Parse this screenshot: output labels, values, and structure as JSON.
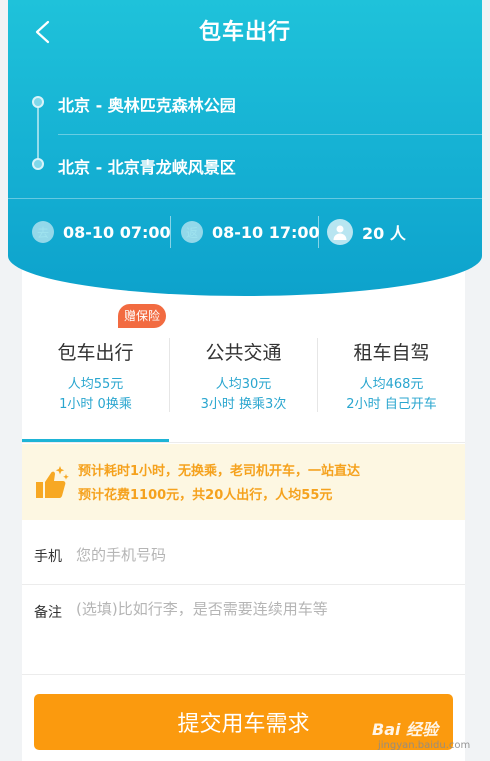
{
  "header": {
    "title": "包车出行",
    "origin": "北京 - 奥林匹克森林公园",
    "destination": "北京 - 北京青龙峡风景区",
    "start_time": "08-10 07:00",
    "end_time": "08-10 17:00",
    "passengers": "20 人"
  },
  "colors": {
    "header_gradient_start": "#1fc2da",
    "header_gradient_end": "#0da2cc",
    "accent": "#1eb4d6",
    "badge": "#f26b41",
    "notice_text": "#f5a21e",
    "submit": "#fb9a0e"
  },
  "tabs": [
    {
      "name": "包车出行",
      "price": "人均55元",
      "detail": "1小时 0换乘",
      "badge": "赠保险",
      "active": true
    },
    {
      "name": "公共交通",
      "price": "人均30元",
      "detail": "3小时 换乘3次",
      "active": false
    },
    {
      "name": "租车自驾",
      "price": "人均468元",
      "detail": "2小时 自己开车",
      "active": false
    }
  ],
  "notice": {
    "icon": "thumbs-up-icon",
    "line1": "预计耗时1小时，无换乘，老司机开车，一站直达",
    "line2": "预计花费1100元，共20人出行，人均55元"
  },
  "form": {
    "phone_label": "手机",
    "phone_placeholder": "您的手机号码",
    "note_label": "备注",
    "note_placeholder": "(选填)比如行李，是否需要连续用车等"
  },
  "submit_label": "提交用车需求",
  "watermark": {
    "main": "Bai 经验",
    "sub": "jingyan.baidu.com"
  }
}
